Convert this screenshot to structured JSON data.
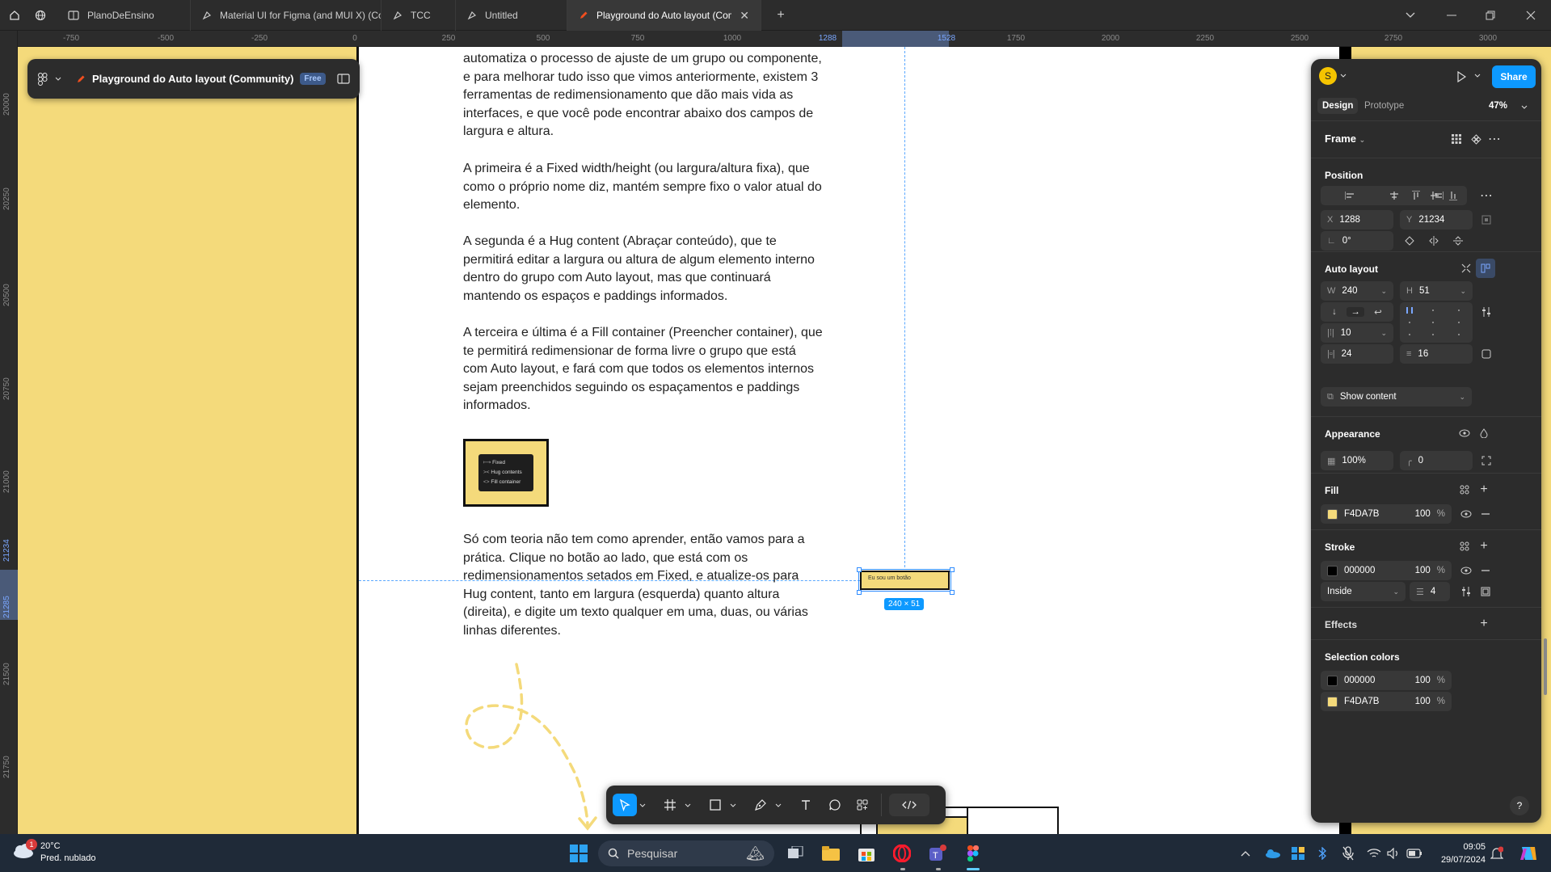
{
  "tabs": [
    {
      "label": "PlanoDeEnsino",
      "icon": "figjam-board-icon"
    },
    {
      "label": "Material UI for Figma (and MUI X) (Co",
      "icon": "community-file-icon"
    },
    {
      "label": "TCC",
      "icon": "community-file-icon"
    },
    {
      "label": "Untitled",
      "icon": "community-file-icon"
    },
    {
      "label": "Playground do Auto layout (Comr",
      "icon": "pencil-icon",
      "active": true
    }
  ],
  "ruler_top": [
    "-750",
    "-500",
    "-250",
    "0",
    "250",
    "500",
    "750",
    "1000",
    "1288",
    "1528",
    "1750",
    "2000",
    "2250",
    "2500",
    "2750",
    "3000"
  ],
  "ruler_left": [
    "20000",
    "20250",
    "20500",
    "20750",
    "21000",
    "21234",
    "21285",
    "21500",
    "21750"
  ],
  "file": {
    "name": "Playground do Auto layout (Community)",
    "badge": "Free"
  },
  "content": {
    "p0": "automatiza o processo de ajuste de um grupo ou componente, e para melhorar tudo isso que vimos anteriormente, existem 3 ferramentas de redimensionamento que dão mais vida as interfaces, e que você pode encontrar abaixo dos campos de largura e altura.",
    "p1": "A primeira é a Fixed width/height (ou largura/altura fixa), que como o próprio nome diz, mantém sempre fixo o valor atual do elemento.",
    "p2": "A segunda é a Hug content (Abraçar conteúdo), que te permitirá editar a largura ou altura de algum elemento interno dentro do grupo com Auto layout, mas que continuará mantendo os espaços e paddings informados.",
    "p3": "A terceira e última é a Fill container (Preencher container), que te permitirá redimensionar de forma livre o grupo que está com Auto layout, e fará com que todos os elementos internos sejam preenchidos seguindo os espaçamentos e paddings informados.",
    "p4": "Só com teoria não tem como aprender, então vamos para a prática. Clique no botão ao lado, que está com os redimensionamentos setados em Fixed, e atualize-os para Hug content, tanto em largura (esquerda) quanto altura (direita), e digite um texto qualquer em uma, duas, ou várias linhas diferentes.",
    "menu_items": [
      "Fixed",
      "Hug contents",
      "Fill container"
    ],
    "selected_button_text": "Eu sou um botão",
    "size_badge": "240 × 51"
  },
  "panel": {
    "avatar": "S",
    "share": "Share",
    "tabs": [
      "Design",
      "Prototype"
    ],
    "zoom": "47%",
    "frame_label": "Frame",
    "position": {
      "title": "Position",
      "x_label": "X",
      "x": "1288",
      "y_label": "Y",
      "y": "21234",
      "rotation": "0°"
    },
    "auto_layout": {
      "title": "Auto layout",
      "w_label": "W",
      "w": "240",
      "h_label": "H",
      "h": "51",
      "gap": "10",
      "pad_h": "24",
      "pad_v": "16",
      "clip": "Show content"
    },
    "appearance": {
      "title": "Appearance",
      "opacity": "100%",
      "radius": "0"
    },
    "fill": {
      "title": "Fill",
      "hex": "F4DA7B",
      "opacity": "100",
      "unit": "%",
      "color": "#F4DA7B"
    },
    "stroke": {
      "title": "Stroke",
      "hex": "000000",
      "opacity": "100",
      "unit": "%",
      "color": "#000000",
      "position": "Inside",
      "weight": "4"
    },
    "effects": {
      "title": "Effects"
    },
    "selection_colors": {
      "title": "Selection colors",
      "items": [
        {
          "hex": "000000",
          "opacity": "100",
          "unit": "%",
          "color": "#000000"
        },
        {
          "hex": "F4DA7B",
          "opacity": "100",
          "unit": "%",
          "color": "#F4DA7B"
        }
      ]
    },
    "help": "?"
  },
  "taskbar": {
    "weather_temp": "20°C",
    "weather_desc": "Pred. nublado",
    "weather_badge": "1",
    "search_placeholder": "Pesquisar",
    "time": "09:05",
    "date": "29/07/2024"
  },
  "colors": {
    "accent": "#0d99ff",
    "canvas_yellow": "#F4DA7B"
  }
}
